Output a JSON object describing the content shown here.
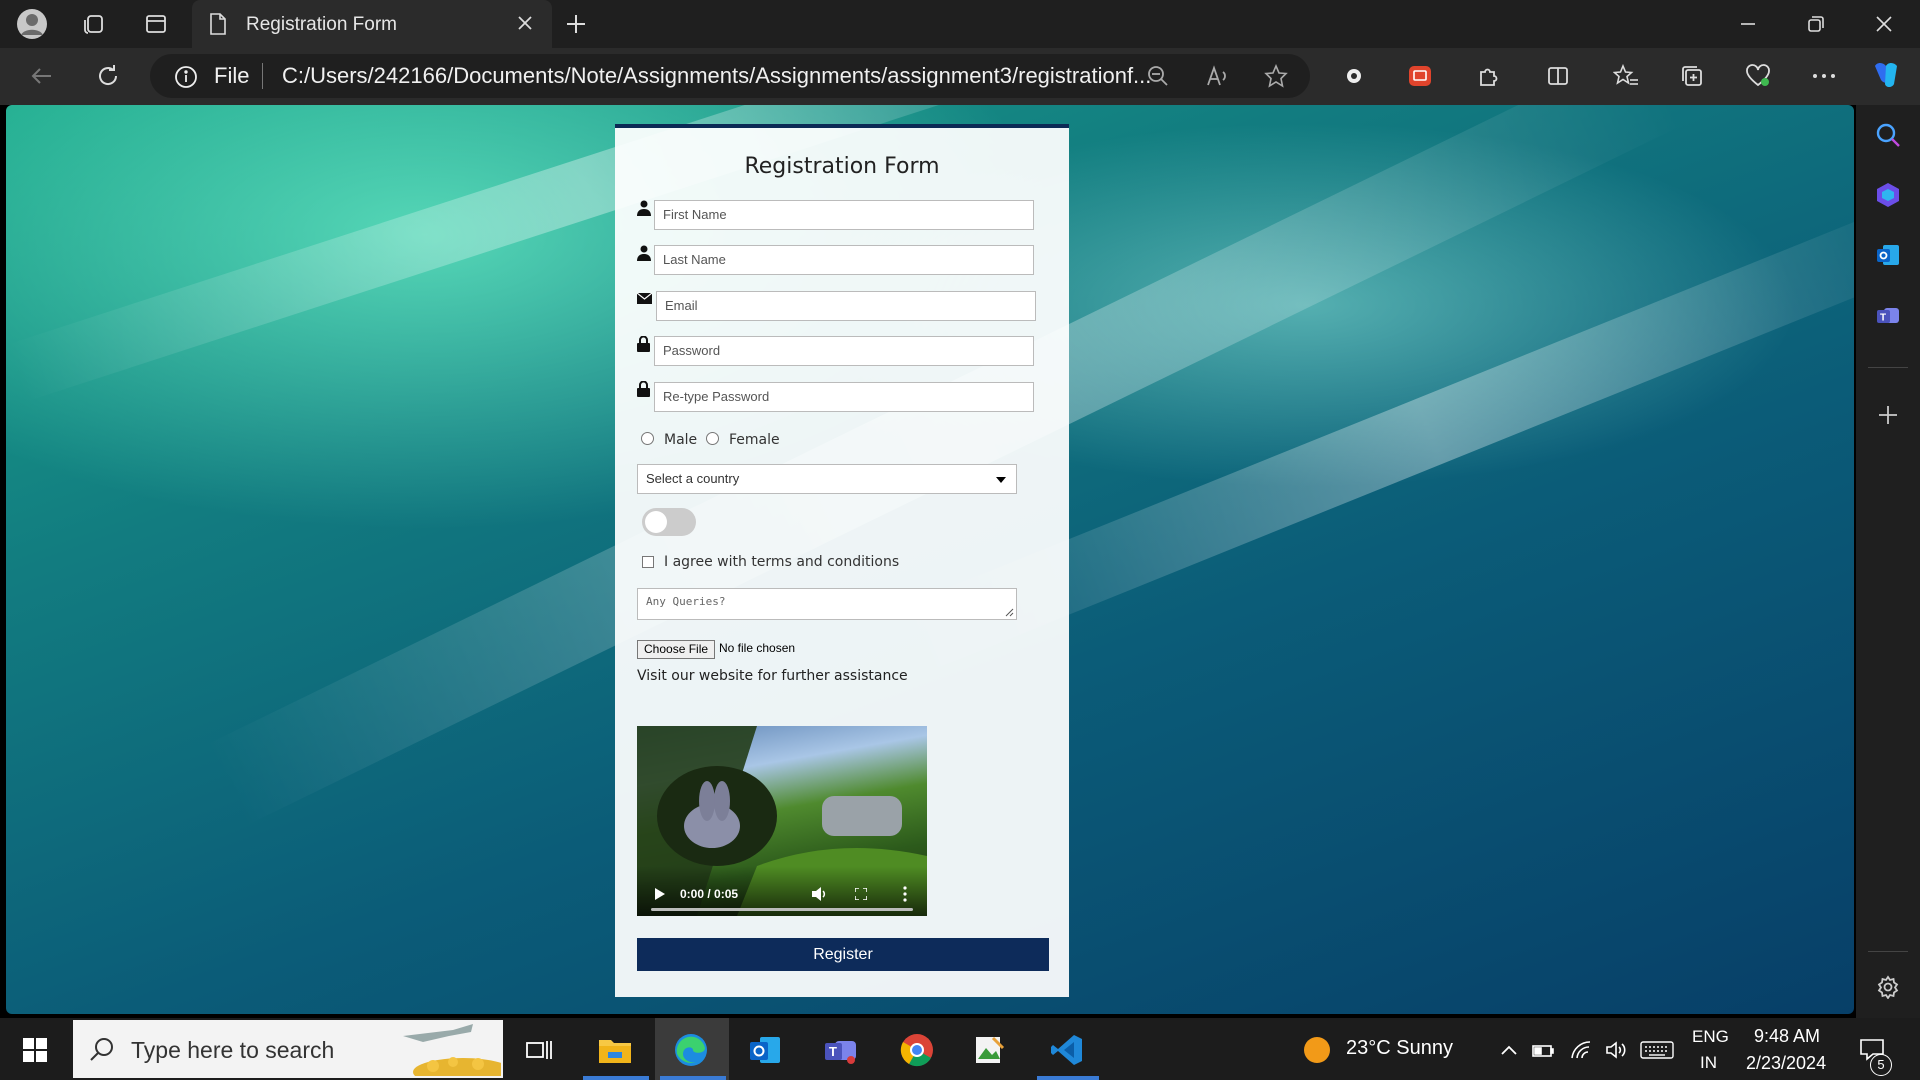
{
  "browser": {
    "tab_title": "Registration Form",
    "address_prefix": "File",
    "url": "C:/Users/242166/Documents/Note/Assignments/Assignments/assignment3/registrationf..."
  },
  "form": {
    "title": "Registration Form",
    "fields": {
      "first_name_placeholder": "First Name",
      "last_name_placeholder": "Last Name",
      "email_placeholder": "Email",
      "password_placeholder": "Password",
      "retype_password_placeholder": "Re-type Password"
    },
    "gender_options": [
      "Male",
      "Female"
    ],
    "country_select": "Select a country",
    "terms_label": "I agree with terms and conditions",
    "queries_placeholder": "Any Queries?",
    "file_button": "Choose File",
    "file_status": "No file chosen",
    "visit_text": "Visit our website for further assistance",
    "video_time": "0:00 / 0:05",
    "register_button": "Register"
  },
  "taskbar": {
    "search_placeholder": "Type here to search",
    "weather": "23°C  Sunny",
    "lang_top": "ENG",
    "lang_bottom": "IN",
    "time": "9:48 AM",
    "date": "2/23/2024",
    "notification_count": "5"
  },
  "colors": {
    "form_accent": "#0d2b5a",
    "titlebar": "#1f1f1f",
    "toolbar": "#2b2b2b"
  }
}
